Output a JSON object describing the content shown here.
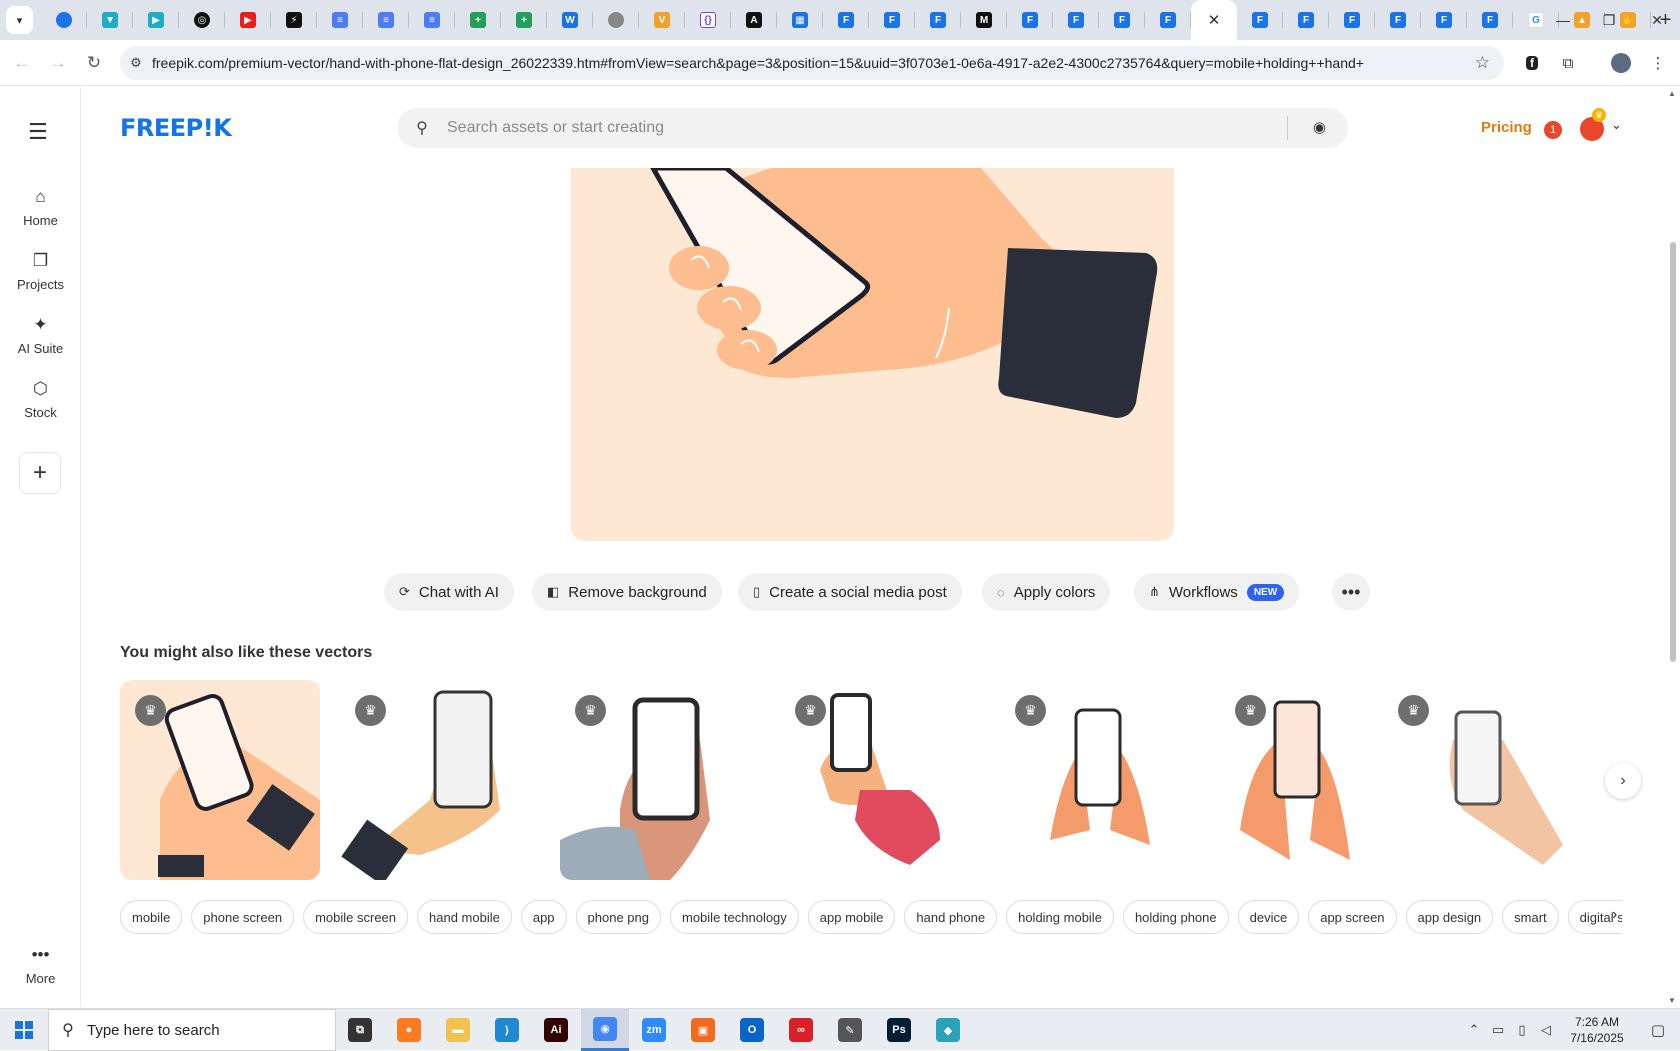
{
  "browser": {
    "tabs": [
      {
        "icon": "globe-half-icon",
        "kind": "blue round",
        "glyph": ""
      },
      {
        "icon": "vpn-shield-icon",
        "kind": "teal",
        "glyph": "▼"
      },
      {
        "icon": "blue-hex-icon",
        "kind": "teal",
        "glyph": "▶"
      },
      {
        "icon": "openai-icon",
        "kind": "dark round",
        "glyph": "◎"
      },
      {
        "icon": "youtube-icon",
        "kind": "red",
        "glyph": "▶"
      },
      {
        "icon": "bolt-app-icon",
        "kind": "dark",
        "glyph": "⚡"
      },
      {
        "icon": "google-docs-icon",
        "kind": "doc",
        "glyph": "≡"
      },
      {
        "icon": "google-docs-icon",
        "kind": "doc",
        "glyph": "≡"
      },
      {
        "icon": "google-docs-icon",
        "kind": "doc",
        "glyph": "≡"
      },
      {
        "icon": "google-sheets-icon",
        "kind": "sheet",
        "glyph": "+"
      },
      {
        "icon": "google-sheets-icon",
        "kind": "sheet",
        "glyph": "+"
      },
      {
        "icon": "word-doc-icon",
        "kind": "blue",
        "glyph": "W"
      },
      {
        "icon": "globe-icon",
        "kind": "grey round",
        "glyph": ""
      },
      {
        "icon": "orange-v-icon",
        "kind": "orange",
        "glyph": "V"
      },
      {
        "icon": "code-braces-icon",
        "kind": "purple",
        "glyph": "{}"
      },
      {
        "icon": "ai-a-icon",
        "kind": "dark",
        "glyph": "A"
      },
      {
        "icon": "grid-app-icon",
        "kind": "blue",
        "glyph": "▦"
      },
      {
        "icon": "form-icon",
        "kind": "blue",
        "glyph": "F"
      },
      {
        "icon": "form-icon",
        "kind": "blue",
        "glyph": "F"
      },
      {
        "icon": "form-icon",
        "kind": "blue",
        "glyph": "F"
      },
      {
        "icon": "medium-m-icon",
        "kind": "dark",
        "glyph": "M"
      },
      {
        "icon": "form-icon",
        "kind": "blue",
        "glyph": "F"
      },
      {
        "icon": "form-icon",
        "kind": "blue",
        "glyph": "F"
      },
      {
        "icon": "form-icon",
        "kind": "blue",
        "glyph": "F"
      },
      {
        "icon": "form-icon",
        "kind": "blue",
        "glyph": "F"
      },
      {
        "icon": "close-icon",
        "kind": "active",
        "glyph": "✕"
      },
      {
        "icon": "form-icon",
        "kind": "blue",
        "glyph": "F"
      },
      {
        "icon": "form-icon",
        "kind": "blue",
        "glyph": "F"
      },
      {
        "icon": "form-icon",
        "kind": "blue",
        "glyph": "F"
      },
      {
        "icon": "form-icon",
        "kind": "blue",
        "glyph": "F"
      },
      {
        "icon": "form-icon",
        "kind": "blue",
        "glyph": "F"
      },
      {
        "icon": "form-icon",
        "kind": "blue",
        "glyph": "F"
      },
      {
        "icon": "google-icon",
        "kind": "google",
        "glyph": "G"
      },
      {
        "icon": "cap-icon",
        "kind": "orange",
        "glyph": "▲"
      },
      {
        "icon": "hand-icon",
        "kind": "orange",
        "glyph": "✋"
      }
    ],
    "new_tab": "+",
    "url": "freepik.com/premium-vector/hand-with-phone-flat-design_26022339.htm#fromView=search&page=3&position=15&uuid=3f0703e1-0e6a-4917-a2e2-4300c2735764&query=mobile+holding++hand+"
  },
  "sidebar": {
    "items": [
      {
        "label": "Home",
        "icon": "home-icon",
        "glyph": "⌂"
      },
      {
        "label": "Projects",
        "icon": "projects-icon",
        "glyph": "❐"
      },
      {
        "label": "AI Suite",
        "icon": "ai-sparkle-icon",
        "glyph": "✦"
      },
      {
        "label": "Stock",
        "icon": "stock-icon",
        "glyph": "⬡"
      }
    ],
    "add_label": "+",
    "more_label": "More"
  },
  "header": {
    "logo": "FREEP!K",
    "search_placeholder": "Search assets or start creating",
    "pricing": "Pricing",
    "notification_count": "1"
  },
  "tools": [
    {
      "label": "Chat with AI",
      "icon": "chat-ai-icon",
      "glyph": "⟳"
    },
    {
      "label": "Remove background",
      "icon": "remove-bg-icon",
      "glyph": "◧"
    },
    {
      "label": "Create a social media post",
      "icon": "phone-icon",
      "glyph": "▯"
    },
    {
      "label": "Apply colors",
      "icon": "palette-icon",
      "glyph": "◌"
    },
    {
      "label": "Workflows",
      "icon": "workflow-icon",
      "glyph": "⋔",
      "badge": "NEW"
    }
  ],
  "related": {
    "title": "You might also like these vectors"
  },
  "tags": [
    "mobile",
    "phone screen",
    "mobile screen",
    "hand mobile",
    "app",
    "phone png",
    "mobile technology",
    "app mobile",
    "hand phone",
    "holding mobile",
    "holding phone",
    "device",
    "app screen",
    "app design",
    "smart",
    "digital sc"
  ],
  "taskbar": {
    "search_text": "Type here to search",
    "apps": [
      {
        "icon": "task-view-icon",
        "color": "#333333",
        "glyph": "⧉"
      },
      {
        "icon": "firefox-icon",
        "color": "#ff7a1f",
        "glyph": "●"
      },
      {
        "icon": "file-explorer-icon",
        "color": "#f2c14e",
        "glyph": "▬"
      },
      {
        "icon": "vscode-icon",
        "color": "#1f8ad2",
        "glyph": "⟩"
      },
      {
        "icon": "illustrator-icon",
        "color": "#330000",
        "glyph": "Ai"
      },
      {
        "icon": "chrome-icon",
        "color": "#4285f4",
        "glyph": "◉"
      },
      {
        "icon": "zoom-icon",
        "color": "#2d8cff",
        "glyph": "zm"
      },
      {
        "icon": "app-orange-icon",
        "color": "#f26b1d",
        "glyph": "▣"
      },
      {
        "icon": "outlook-icon",
        "color": "#0a64c9",
        "glyph": "O"
      },
      {
        "icon": "creative-cloud-icon",
        "color": "#da1f26",
        "glyph": "∞"
      },
      {
        "icon": "pen-tool-icon",
        "color": "#555555",
        "glyph": "✎"
      },
      {
        "icon": "photoshop-icon",
        "color": "#001e36",
        "glyph": "Ps"
      },
      {
        "icon": "crystal-app-icon",
        "color": "#2aa3b8",
        "glyph": "◆"
      }
    ],
    "time": "7:26 AM",
    "date": "7/16/2025"
  },
  "colors": {
    "brand": "#1273eb",
    "pricing": "#e07b10",
    "hero_bg": "#ffe8d3",
    "skin": "#fdbd8f",
    "sleeve": "#2a2d3a"
  }
}
